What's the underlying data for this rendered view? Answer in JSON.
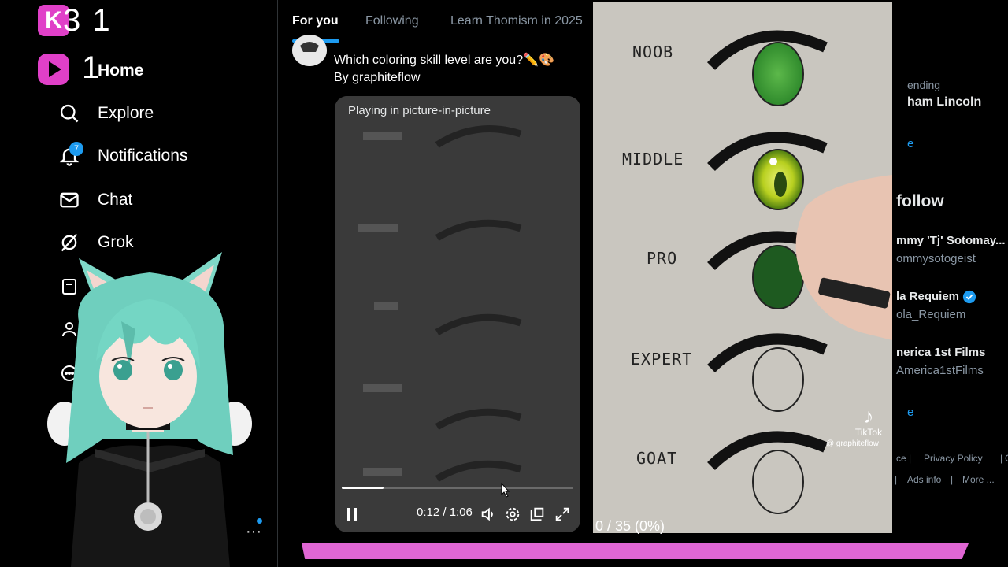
{
  "overlay": {
    "brand_text": "3 1",
    "home_count": "1",
    "page_counter": "0 / 35 (0%)",
    "colors": {
      "brand": "#e040c8",
      "bottom_bar": "#e066d4",
      "accent": "#1d9bf0"
    }
  },
  "sidebar": {
    "home_label": "Home",
    "items": [
      {
        "label": "Explore",
        "icon": "search-icon"
      },
      {
        "label": "Notifications",
        "icon": "bell-icon",
        "badge": "7"
      },
      {
        "label": "Chat",
        "icon": "mail-icon"
      },
      {
        "label": "Grok",
        "icon": "grok-icon"
      }
    ]
  },
  "feed": {
    "tabs": [
      {
        "label": "For you",
        "active": true
      },
      {
        "label": "Following",
        "active": false
      },
      {
        "label": "Learn Thomism in 2025",
        "active": false
      }
    ],
    "post": {
      "text": "Which coloring skill level are you?✏️🎨",
      "byline": "By graphiteflow"
    },
    "video": {
      "pip_text": "Playing in picture-in-picture",
      "time": "0:12 / 1:06",
      "progress": 0.18
    }
  },
  "right": {
    "trending_label": "ending",
    "trending_topic": "ham Lincoln",
    "show_more_1": "e",
    "follow_header": "follow",
    "follow_list": [
      {
        "name": "mmy 'Tj' Sotomay...",
        "handle": "ommysotogeist",
        "verified": false
      },
      {
        "name": "la Requiem",
        "handle": "ola_Requiem",
        "verified": true
      },
      {
        "name": "nerica 1st Films",
        "handle": "America1stFilms",
        "verified": false
      }
    ],
    "show_more_2": "e",
    "footer": [
      "ce",
      "Privacy Policy",
      "C",
      "Ads info",
      "More ..."
    ]
  },
  "tiktok": {
    "levels": [
      "NOOB",
      "MIDDLE",
      "PRO",
      "EXPERT",
      "GOAT"
    ],
    "logo": "TikTok",
    "user": "@ graphiteflow"
  }
}
